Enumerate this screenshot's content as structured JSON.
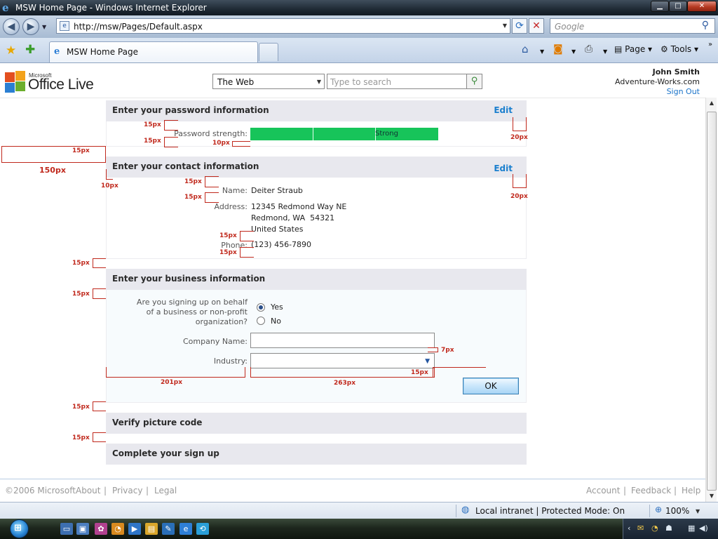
{
  "browser": {
    "window_title": "MSW Home Page - Windows Internet Explorer",
    "url": "http://msw/Pages/Default.aspx",
    "search_placeholder": "Google",
    "tab_label": "MSW Home Page",
    "page_menu": "Page",
    "tools_menu": "Tools",
    "status_text": "Local intranet | Protected Mode: On",
    "zoom": "100%"
  },
  "header": {
    "logo_small": "Microsoft",
    "logo_large": "Office Live",
    "scope_value": "The Web",
    "search_placeholder": "Type to search",
    "user_name": "John Smith",
    "user_domain": "Adventure-Works.com",
    "sign_out": "Sign Out"
  },
  "sections": {
    "password": {
      "title": "Enter your password information",
      "edit": "Edit",
      "strength_label": "Password strength:",
      "strength_value": "Strong",
      "strength_fraction": 1.0
    },
    "contact": {
      "title": "Enter your contact information",
      "edit": "Edit",
      "name_label": "Name:",
      "name_value": "Deiter Straub",
      "address_label": "Address:",
      "address_line1": "12345 Redmond Way NE",
      "address_line2": "Redmond, WA  54321",
      "address_line3": "United States",
      "phone_label": "Phone:",
      "phone_value": "(123) 456-7890"
    },
    "business": {
      "title": "Enter your business information",
      "question_line1": "Are you signing up on behalf",
      "question_line2": "of a business or non-profit",
      "question_line3": "organization?",
      "yes_label": "Yes",
      "no_label": "No",
      "selected": "Yes",
      "company_label": "Company Name:",
      "company_value": "",
      "industry_label": "Industry:",
      "industry_value": "",
      "ok_label": "OK"
    },
    "verify": {
      "title": "Verify picture code"
    },
    "complete": {
      "title": "Complete your sign up"
    }
  },
  "annotations": {
    "a15": "15px",
    "a10": "10px",
    "a20": "20px",
    "a150": "150px",
    "a7": "7px",
    "a201": "201px",
    "a263": "263px"
  },
  "footer": {
    "copyright": "©2006 Microsoft",
    "about": "About",
    "privacy": "Privacy",
    "legal": "Legal",
    "account": "Account",
    "feedback": "Feedback",
    "help": "Help"
  },
  "icons": [
    "ie-icon",
    "back-icon",
    "forward-icon",
    "refresh-icon",
    "stop-icon",
    "search-icon",
    "star-icon",
    "add-favorite-icon",
    "home-icon",
    "feeds-icon",
    "print-icon",
    "page-icon",
    "tools-icon",
    "globe-icon",
    "zoom-icon",
    "windows-start-icon"
  ],
  "colors": {
    "strength_bar": "#17c45a",
    "edit_link": "#1a7fce",
    "annotation": "#c0281c",
    "section_header_bg": "#e8e8ee"
  }
}
